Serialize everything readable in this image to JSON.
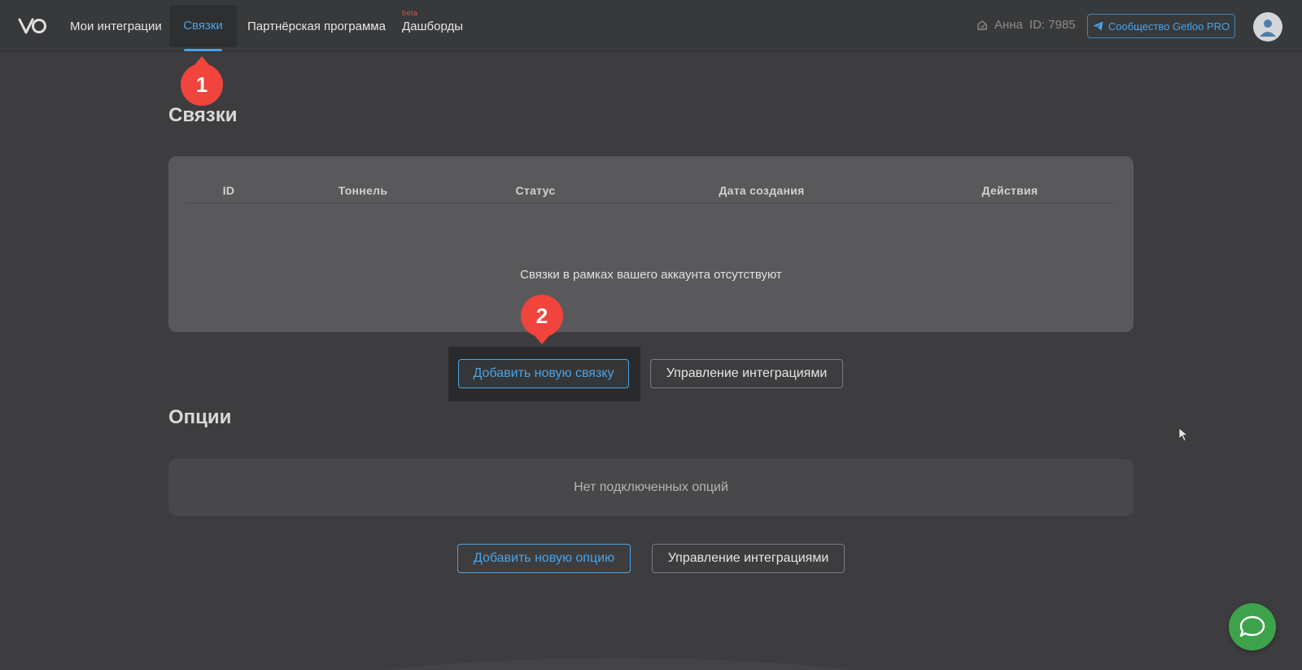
{
  "header": {
    "logo_icon": "vo-logo-icon",
    "nav": [
      {
        "label": "Мои интеграции"
      },
      {
        "label": "Связки"
      },
      {
        "label": "Партнёрская программа"
      },
      {
        "label": "Дашборды",
        "badge": "beta"
      }
    ],
    "user": {
      "name": "Анна",
      "id_label": "ID: 7985"
    },
    "community_button": "Сообщество Getloo PRO",
    "colors": {
      "accent": "#4aa3e6",
      "badge": "#d9534f"
    }
  },
  "markers": {
    "first": "1",
    "second": "2"
  },
  "links_section": {
    "title": "Связки",
    "columns": [
      "ID",
      "Тоннель",
      "Статус",
      "Дата создания",
      "Действия"
    ],
    "empty_text": "Связки в рамках вашего аккаунта отсутствуют",
    "add_button": "Добавить новую связку",
    "manage_button": "Управление интеграциями"
  },
  "options_section": {
    "title": "Опции",
    "empty_text": "Нет подключенных опций",
    "add_button": "Добавить новую опцию",
    "manage_button": "Управление интеграциями"
  },
  "chat_button_icon": "chat-bubble-icon"
}
